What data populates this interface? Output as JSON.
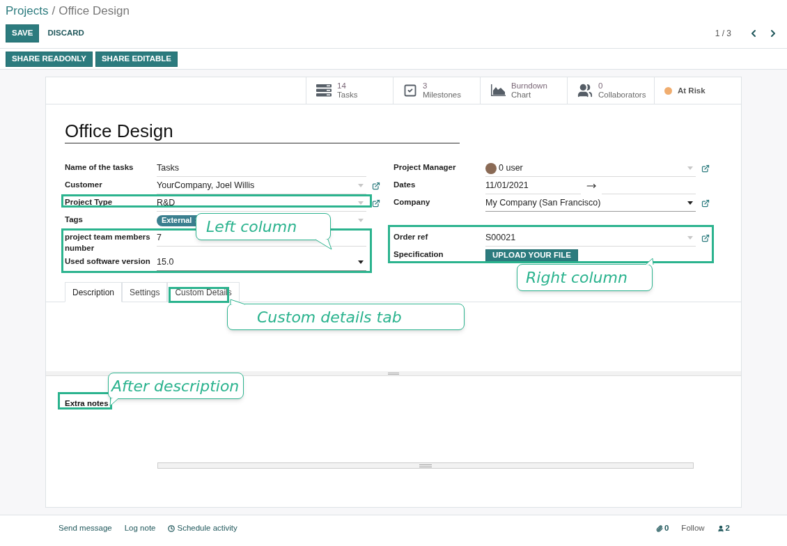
{
  "breadcrumb": {
    "parent": "Projects",
    "separator": "/",
    "current": "Office Design"
  },
  "control_buttons": [
    {
      "label": "SAVE",
      "kind": "primary"
    },
    {
      "label": "DISCARD",
      "kind": "link"
    }
  ],
  "pager": {
    "counter": "1 / 3"
  },
  "share_buttons": [
    "SHARE READONLY",
    "SHARE EDITABLE"
  ],
  "stat_buttons": [
    {
      "kind": "tasks",
      "value": "14",
      "label": "Tasks"
    },
    {
      "kind": "milestones",
      "value": "3",
      "label": "Milestones"
    },
    {
      "kind": "chart",
      "value": "Burndown",
      "label": "Chart"
    },
    {
      "kind": "collaborators",
      "value": "0",
      "label": "Collaborators"
    },
    {
      "kind": "status",
      "label": "At Risk",
      "color": "#f0ad6f"
    }
  ],
  "title": "Office Design",
  "left_fields": [
    {
      "label": "Name of the tasks",
      "kind": "text",
      "value": "Tasks",
      "external_link": false
    },
    {
      "label": "Customer",
      "kind": "many2one",
      "value": "YourCompany, Joel Willis",
      "external_link": true
    },
    {
      "label": "Project Type",
      "kind": "many2one",
      "value": "R&D",
      "external_link": true
    },
    {
      "label": "Tags",
      "kind": "tags",
      "tags": [
        "External"
      ],
      "external_link": false
    },
    {
      "label": "project team members number",
      "kind": "text",
      "value": "7",
      "external_link": false
    },
    {
      "label": "Used software version",
      "kind": "selection",
      "value": "15.0",
      "external_link": false
    }
  ],
  "right_fields": [
    {
      "label": "Project Manager",
      "kind": "user",
      "value": "0 user",
      "external_link": true
    },
    {
      "label": "Dates",
      "kind": "daterange",
      "value": "11/01/2021",
      "external_link": false
    },
    {
      "label": "Company",
      "kind": "selection",
      "value": "My Company (San Francisco)",
      "external_link": true
    }
  ],
  "right_custom_fields": [
    {
      "label": "Order ref",
      "kind": "many2one",
      "value": "S00021",
      "external_link": true
    },
    {
      "label": "Specification",
      "kind": "binary",
      "value": "UPLOAD YOUR FILE",
      "external_link": false
    }
  ],
  "tabs": [
    {
      "label": "Description",
      "selected": true
    },
    {
      "label": "Settings",
      "selected": false
    },
    {
      "label": "Custom Details",
      "selected": false
    }
  ],
  "extra_notes_label": "Extra notes",
  "chatter": {
    "actions": [
      {
        "label": "Send message",
        "kind": "plain"
      },
      {
        "label": "Log note",
        "kind": "plain"
      },
      {
        "label": "Schedule activity",
        "kind": "clock"
      }
    ],
    "attachments": "0",
    "follow": "Follow",
    "followers": "2"
  },
  "callouts": [
    {
      "text": "Left column"
    },
    {
      "text": "Right column"
    },
    {
      "text": "Custom details tab"
    },
    {
      "text": "After description"
    }
  ]
}
